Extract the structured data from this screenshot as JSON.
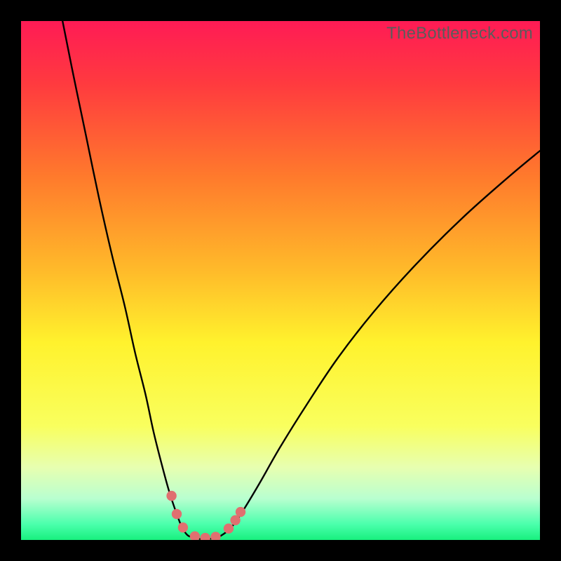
{
  "watermark": "TheBottleneck.com",
  "chart_data": {
    "type": "line",
    "title": "",
    "xlabel": "",
    "ylabel": "",
    "xlim": [
      0,
      100
    ],
    "ylim": [
      0,
      100
    ],
    "background_gradient_stops": [
      {
        "pct": 0,
        "color": "#ff1b55"
      },
      {
        "pct": 12,
        "color": "#ff3a3f"
      },
      {
        "pct": 30,
        "color": "#ff7a2c"
      },
      {
        "pct": 48,
        "color": "#ffba2a"
      },
      {
        "pct": 62,
        "color": "#fff22d"
      },
      {
        "pct": 78,
        "color": "#f9ff5e"
      },
      {
        "pct": 86,
        "color": "#e7ffb0"
      },
      {
        "pct": 92,
        "color": "#b9ffd0"
      },
      {
        "pct": 97,
        "color": "#4affac"
      },
      {
        "pct": 100,
        "color": "#18f07e"
      }
    ],
    "series": [
      {
        "name": "left-curve",
        "x": [
          8,
          10,
          12.5,
          15,
          17.5,
          20,
          22,
          24,
          25.5,
          27,
          28.5,
          30,
          31,
          32,
          33
        ],
        "y": [
          100,
          90,
          78,
          66,
          55,
          45,
          36,
          28,
          21,
          15,
          9.5,
          5,
          2.5,
          1,
          0.5
        ]
      },
      {
        "name": "right-curve",
        "x": [
          38,
          39.5,
          41,
          43,
          46,
          50,
          55,
          61,
          68,
          76,
          85,
          94,
          100
        ],
        "y": [
          0.5,
          1.5,
          3,
          6,
          11,
          18,
          26,
          35,
          44,
          53,
          62,
          70,
          75
        ]
      },
      {
        "name": "valley-floor",
        "x": [
          33,
          34.5,
          36,
          37,
          38
        ],
        "y": [
          0.5,
          0.2,
          0.2,
          0.3,
          0.5
        ]
      }
    ],
    "markers": [
      {
        "x": 29,
        "y": 8.5
      },
      {
        "x": 30,
        "y": 5.0
      },
      {
        "x": 31.2,
        "y": 2.4
      },
      {
        "x": 33.5,
        "y": 0.7
      },
      {
        "x": 35.5,
        "y": 0.4
      },
      {
        "x": 37.5,
        "y": 0.6
      },
      {
        "x": 40,
        "y": 2.2
      },
      {
        "x": 41.3,
        "y": 3.8
      },
      {
        "x": 42.3,
        "y": 5.4
      }
    ],
    "marker_color": "#e07070",
    "curve_color": "#000000",
    "curve_width": 2.4
  }
}
